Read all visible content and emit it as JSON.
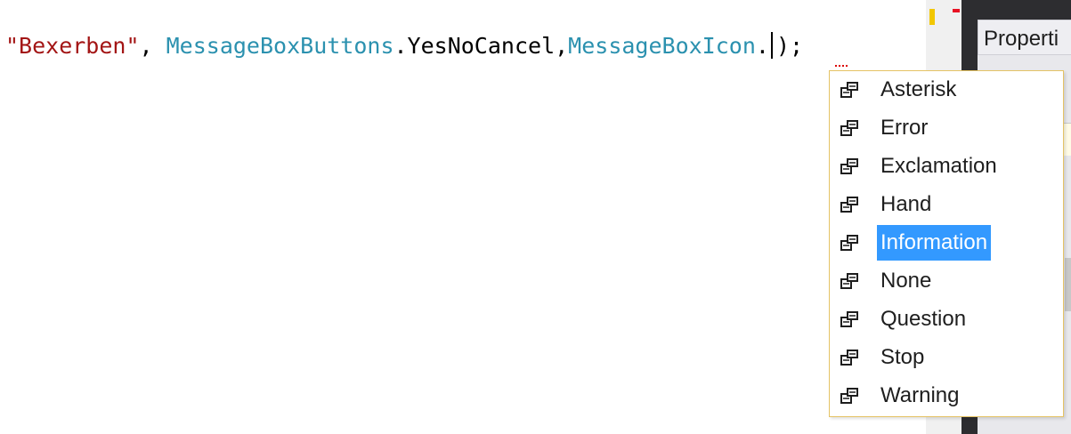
{
  "editor": {
    "code_tokens": [
      {
        "text": "\"Bexerben\"",
        "kind": "string"
      },
      {
        "text": ", ",
        "kind": "plain"
      },
      {
        "text": "MessageBoxButtons",
        "kind": "type"
      },
      {
        "text": ".YesNoCancel,",
        "kind": "plain"
      },
      {
        "text": "MessageBoxIcon",
        "kind": "type"
      },
      {
        "text": ".",
        "kind": "plain"
      },
      {
        "text": ");",
        "kind": "plain_after_caret"
      }
    ]
  },
  "properties_panel": {
    "title": "Properti"
  },
  "completion_list": {
    "items": [
      {
        "label": "Asterisk",
        "icon": "enum-member-icon",
        "selected": false
      },
      {
        "label": "Error",
        "icon": "enum-member-icon",
        "selected": false
      },
      {
        "label": "Exclamation",
        "icon": "enum-member-icon",
        "selected": false
      },
      {
        "label": "Hand",
        "icon": "enum-member-icon",
        "selected": false
      },
      {
        "label": "Information",
        "icon": "enum-member-icon",
        "selected": true
      },
      {
        "label": "None",
        "icon": "enum-member-icon",
        "selected": false
      },
      {
        "label": "Question",
        "icon": "enum-member-icon",
        "selected": false
      },
      {
        "label": "Stop",
        "icon": "enum-member-icon",
        "selected": false
      },
      {
        "label": "Warning",
        "icon": "enum-member-icon",
        "selected": false
      }
    ]
  },
  "colors": {
    "string": "#a31515",
    "type": "#2b91af",
    "selection": "#3399ff",
    "list_border": "#e5c365"
  }
}
